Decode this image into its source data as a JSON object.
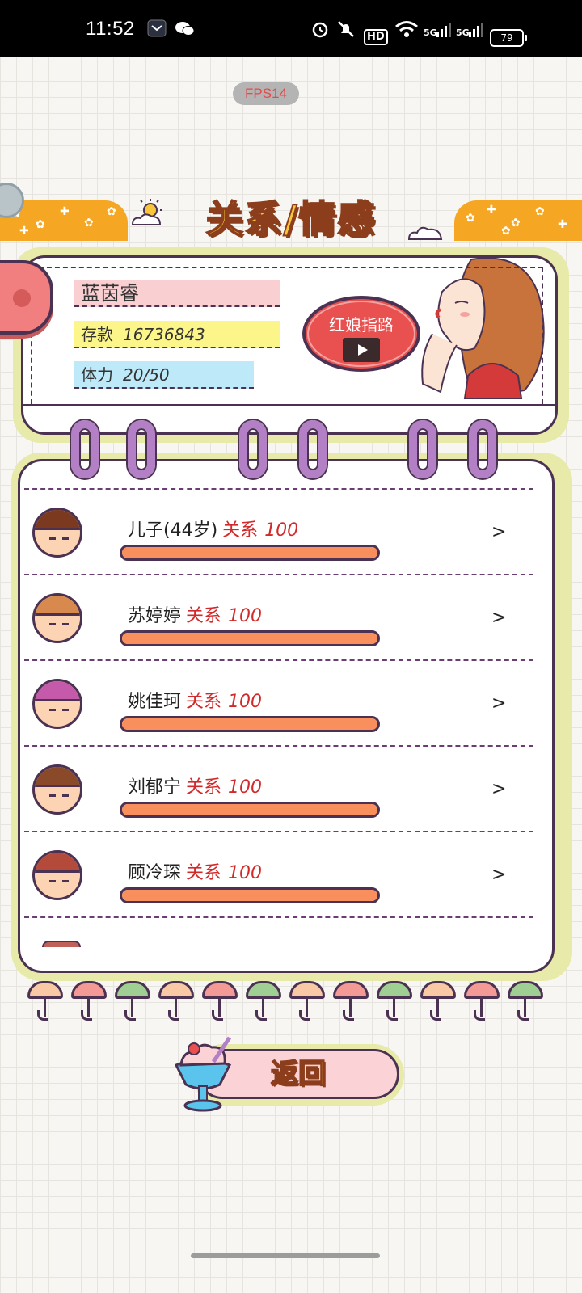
{
  "status_bar": {
    "time": "11:52",
    "icons": [
      "message-notification-icon",
      "wechat-icon",
      "alarm-icon",
      "mute-icon",
      "hd-voice-icon",
      "wifi-icon",
      "signal-5g-icon",
      "signal-5g-icon"
    ],
    "hd_label": "HD",
    "signal_label": "5G",
    "battery": "79"
  },
  "fps_badge": "FPS14",
  "header": {
    "title": "关系/情感"
  },
  "profile": {
    "name": "蓝茵睿",
    "savings_label": "存款",
    "savings_value": "16736843",
    "stamina_label": "体力",
    "stamina_value": "20/50",
    "matchmaker_button": "红娘指路"
  },
  "relations": [
    {
      "name": "儿子(44岁)",
      "rel_label": "关系",
      "value": "100",
      "level": 1.0,
      "hair_color": "#7b3a1f",
      "chevron": ">"
    },
    {
      "name": "苏婷婷",
      "rel_label": "关系",
      "value": "100",
      "level": 1.0,
      "hair_color": "#d88a4e",
      "chevron": ">"
    },
    {
      "name": "姚佳珂",
      "rel_label": "关系",
      "value": "100",
      "level": 1.0,
      "hair_color": "#c45aa9",
      "chevron": ">"
    },
    {
      "name": "刘郁宁",
      "rel_label": "关系",
      "value": "100",
      "level": 1.0,
      "hair_color": "#8a4a2a",
      "chevron": ">"
    },
    {
      "name": "顾冷琛",
      "rel_label": "关系",
      "value": "100",
      "level": 1.0,
      "hair_color": "#b44a3a",
      "chevron": ">"
    }
  ],
  "back_button": "返回",
  "colors": {
    "accent_orange": "#f98f5c",
    "outline_purple": "#4b3152",
    "relation_red": "#d22a2a",
    "title_yellow": "#f8c63a"
  }
}
